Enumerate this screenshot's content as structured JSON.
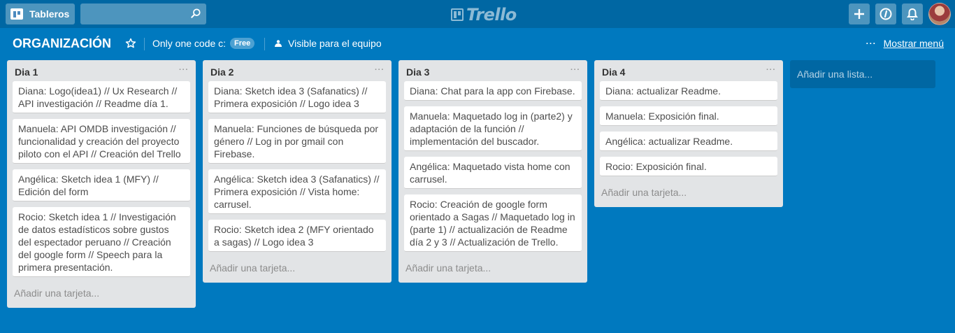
{
  "header": {
    "boards_label": "Tableros",
    "search_placeholder": "",
    "logo_text": "Trello",
    "add_icon": "plus-icon",
    "info_icon": "info-icon",
    "bell_icon": "bell-icon"
  },
  "board": {
    "title": "ORGANIZACIÓN",
    "team_name": "Only one code c:",
    "plan_badge": "Free",
    "visibility": "Visible para el equipo",
    "menu_label": "Mostrar menú",
    "menu_dots": "···"
  },
  "lists": [
    {
      "title": "Dia 1",
      "cards": [
        "Diana: Logo(idea1) // Ux Research // API investigación // Readme día 1.",
        "Manuela: API OMDB investigación // funcionalidad y creación del proyecto piloto con el API // Creación del Trello",
        "Angélica: Sketch idea 1 (MFY) // Edición del form",
        "Rocio: Sketch idea 1 // Investigación de datos estadísticos sobre gustos del espectador peruano // Creación del google form // Speech para la primera presentación."
      ],
      "add_card": "Añadir una tarjeta..."
    },
    {
      "title": "Dia 2",
      "cards": [
        "Diana: Sketch idea 3 (Safanatics) // Primera exposición // Logo idea 3",
        "Manuela: Funciones de búsqueda por género // Log in por gmail con Firebase.",
        "Angélica: Sketch idea 3 (Safanatics) // Primera exposición // Vista home: carrusel.",
        "Rocio: Sketch idea 2 (MFY orientado a sagas) // Logo idea 3"
      ],
      "add_card": "Añadir una tarjeta..."
    },
    {
      "title": "Dia 3",
      "cards": [
        "Diana: Chat para la app con Firebase.",
        "Manuela: Maquetado log in (parte2) y adaptación de la función // implementación del buscador.",
        "Angélica: Maquetado vista home con carrusel.",
        "Rocio: Creación de google form orientado a Sagas // Maquetado log in (parte 1) // actualización de Readme día 2 y 3 // Actualización de Trello."
      ],
      "add_card": "Añadir una tarjeta..."
    },
    {
      "title": "Dia 4",
      "cards": [
        "Diana: actualizar Readme.",
        "Manuela: Exposición final.",
        "Angélica: actualizar Readme.",
        "Rocio: Exposición final."
      ],
      "add_card": "Añadir una tarjeta..."
    }
  ],
  "add_list": "Añadir una lista..."
}
